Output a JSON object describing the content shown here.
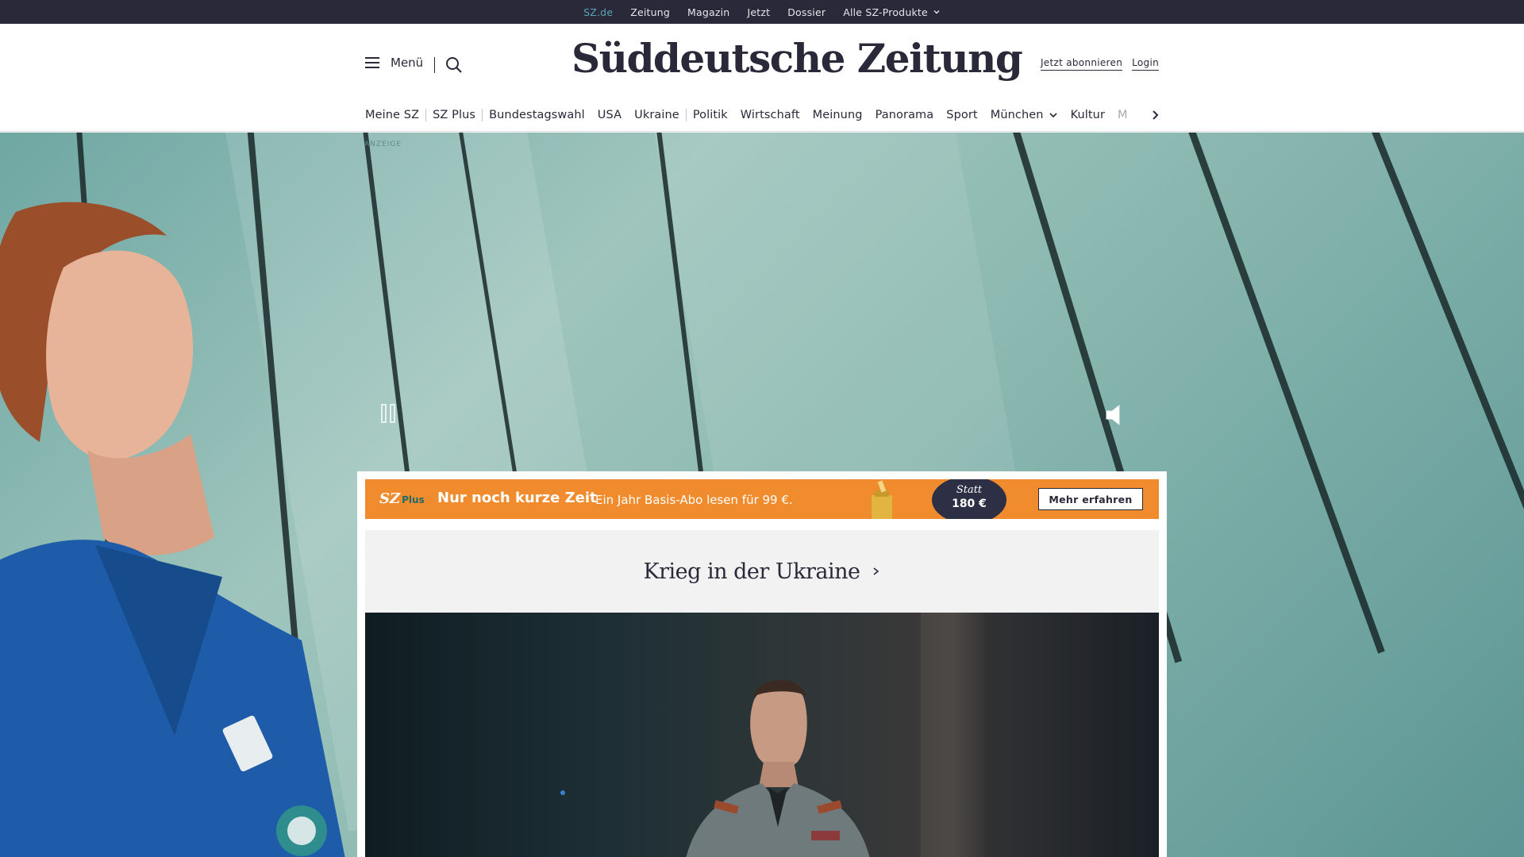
{
  "topbar": {
    "links": [
      "SZ.de",
      "Zeitung",
      "Magazin",
      "Jetzt",
      "Dossier"
    ],
    "products_label": "Alle SZ-Produkte"
  },
  "header": {
    "menu_label": "Menü",
    "logo": "Süddeutsche Zeitung",
    "subscribe_label": "Jetzt abonnieren",
    "login_label": "Login"
  },
  "nav": {
    "items": [
      "Meine SZ",
      "SZ Plus",
      "Bundestagswahl",
      "USA",
      "Ukraine",
      "Politik",
      "Wirtschaft",
      "Meinung",
      "Panorama",
      "Sport",
      "München",
      "Kultur",
      "M"
    ]
  },
  "ad": {
    "label": "ANZEIGE"
  },
  "promo": {
    "logo_main": "SZ",
    "logo_sub": "Plus",
    "title": "Nur noch kurze Zeit",
    "text": "Ein Jahr Basis-Abo lesen für 99 €.",
    "badge_top": "Statt",
    "badge_price": "180 €",
    "button": "Mehr erfahren"
  },
  "topic": {
    "title": "Krieg in der Ukraine"
  },
  "colors": {
    "dark": "#29293a",
    "accent": "#5aa6b8",
    "promo": "#f08c2e",
    "badge": "#2d2f45"
  }
}
